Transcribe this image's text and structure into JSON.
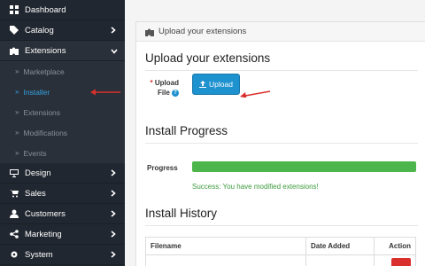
{
  "sidebar": {
    "items": [
      {
        "label": "Dashboard",
        "icon": "dashboard-icon",
        "has_chevron": false
      },
      {
        "label": "Catalog",
        "icon": "tag-icon",
        "has_chevron": true
      },
      {
        "label": "Extensions",
        "icon": "puzzle-icon",
        "has_chevron": true,
        "open": true
      }
    ],
    "sub_items": [
      {
        "label": "Marketplace",
        "active": false
      },
      {
        "label": "Installer",
        "active": true
      },
      {
        "label": "Extensions",
        "active": false
      },
      {
        "label": "Modifications",
        "active": false
      },
      {
        "label": "Events",
        "active": false
      }
    ],
    "items_after": [
      {
        "label": "Design",
        "icon": "monitor-icon",
        "has_chevron": true
      },
      {
        "label": "Sales",
        "icon": "cart-icon",
        "has_chevron": true
      },
      {
        "label": "Customers",
        "icon": "user-icon",
        "has_chevron": true
      },
      {
        "label": "Marketing",
        "icon": "share-icon",
        "has_chevron": true
      },
      {
        "label": "System",
        "icon": "cog-icon",
        "has_chevron": true
      }
    ]
  },
  "panel": {
    "heading": "Upload your extensions",
    "upload_section_title": "Upload your extensions",
    "upload_label_line1": "Upload",
    "upload_label_line2": "File",
    "required_mark": "*",
    "help_mark": "?",
    "upload_button": "Upload",
    "progress_section_title": "Install Progress",
    "progress_label": "Progress",
    "progress_fraction": 1.0,
    "progress_color": "#4cb64c",
    "progress_message": "Success: You have modified extensions!",
    "history_section_title": "Install History",
    "history_columns": [
      "Filename",
      "Date Added",
      "Action"
    ]
  },
  "colors": {
    "sidebar_bg": "#212730",
    "accent": "#1e91cf",
    "active_link": "#34a0df",
    "arrow": "#d9302e",
    "danger": "#d9302e"
  }
}
